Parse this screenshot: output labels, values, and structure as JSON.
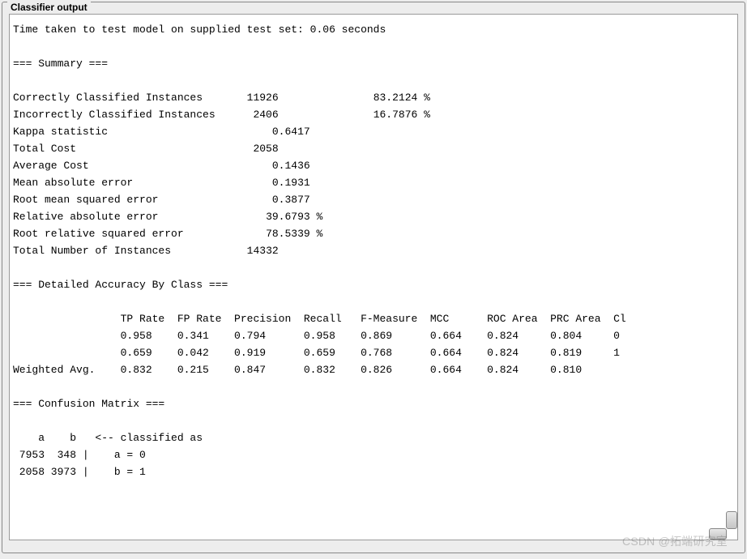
{
  "panel": {
    "title": "Classifier output"
  },
  "time_line": "Time taken to test model on supplied test set: 0.06 seconds",
  "summary_header": "=== Summary ===",
  "summary": {
    "correct_label": "Correctly Classified Instances",
    "correct_count": "11926",
    "correct_pct": "83.2124 %",
    "incorrect_label": "Incorrectly Classified Instances",
    "incorrect_count": "2406",
    "incorrect_pct": "16.7876 %",
    "kappa_label": "Kappa statistic",
    "kappa": "0.6417",
    "totalcost_label": "Total Cost",
    "totalcost": "2058",
    "avgcost_label": "Average Cost",
    "avgcost": "0.1436",
    "mae_label": "Mean absolute error",
    "mae": "0.1931",
    "rmse_label": "Root mean squared error",
    "rmse": "0.3877",
    "rae_label": "Relative absolute error",
    "rae": "39.6793 %",
    "rrse_label": "Root relative squared error",
    "rrse": "78.5339 %",
    "total_label": "Total Number of Instances",
    "total": "14332"
  },
  "detail_header": "=== Detailed Accuracy By Class ===",
  "detail_columns": "                 TP Rate  FP Rate  Precision  Recall   F-Measure  MCC      ROC Area  PRC Area  Cl",
  "detail_row0": "                 0.958    0.341    0.794      0.958    0.869      0.664    0.824     0.804     0",
  "detail_row1": "                 0.659    0.042    0.919      0.659    0.768      0.664    0.824     0.819     1",
  "detail_rowW": "Weighted Avg.    0.832    0.215    0.847      0.832    0.826      0.664    0.824     0.810",
  "confusion_header": "=== Confusion Matrix ===",
  "confusion_h": "    a    b   <-- classified as",
  "confusion_r0": " 7953  348 |    a = 0",
  "confusion_r1": " 2058 3973 |    b = 1",
  "watermark": "CSDN @拓端研究室",
  "chart_data": {
    "type": "table",
    "title": "Detailed Accuracy By Class",
    "columns": [
      "Class",
      "TP Rate",
      "FP Rate",
      "Precision",
      "Recall",
      "F-Measure",
      "MCC",
      "ROC Area",
      "PRC Area"
    ],
    "rows": [
      [
        "0",
        0.958,
        0.341,
        0.794,
        0.958,
        0.869,
        0.664,
        0.824,
        0.804
      ],
      [
        "1",
        0.659,
        0.042,
        0.919,
        0.659,
        0.768,
        0.664,
        0.824,
        0.819
      ],
      [
        "Weighted Avg.",
        0.832,
        0.215,
        0.847,
        0.832,
        0.826,
        0.664,
        0.824,
        0.81
      ]
    ],
    "confusion_matrix": {
      "labels": [
        "0",
        "1"
      ],
      "matrix": [
        [
          7953,
          348
        ],
        [
          2058,
          3973
        ]
      ]
    },
    "summary_metrics": {
      "correctly_classified": 11926,
      "correctly_classified_pct": 83.2124,
      "incorrectly_classified": 2406,
      "incorrectly_classified_pct": 16.7876,
      "kappa": 0.6417,
      "total_cost": 2058,
      "average_cost": 0.1436,
      "mean_absolute_error": 0.1931,
      "root_mean_squared_error": 0.3877,
      "relative_absolute_error_pct": 39.6793,
      "root_relative_squared_error_pct": 78.5339,
      "total_instances": 14332,
      "test_time_seconds": 0.06
    }
  }
}
